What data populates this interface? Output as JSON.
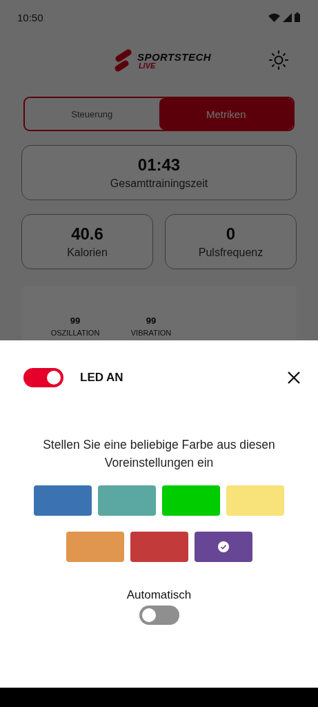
{
  "status_bar": {
    "time": "10:50"
  },
  "header": {
    "brand": "SPORTSTECH",
    "sub": "LIVE"
  },
  "tabs": [
    {
      "label": "Steuerung",
      "selected": false
    },
    {
      "label": "Metriken",
      "selected": true
    }
  ],
  "metrics": [
    {
      "value": "01:43",
      "label": "Gesamttrainingszeit"
    },
    {
      "value": "40.6",
      "label": "Kalorien"
    },
    {
      "value": "0",
      "label": "Pulsfrequenz"
    }
  ],
  "panel": {
    "stats": [
      {
        "value": "99",
        "label": "OSZILLATION"
      },
      {
        "value": "99",
        "label": "VIBRATION"
      }
    ]
  },
  "sheet": {
    "led_toggle": {
      "on": true,
      "label": "LED AN"
    },
    "prompt": "Stellen Sie eine beliebige Farbe aus diesen Voreinstellungen ein",
    "swatch_rows": [
      [
        {
          "color": "#3b73b2",
          "selected": false
        },
        {
          "color": "#5aa8a1",
          "selected": false
        },
        {
          "color": "#00cc00",
          "selected": false
        },
        {
          "color": "#f8e27a",
          "selected": false
        }
      ],
      [
        {
          "color": "#e0964e",
          "selected": false
        },
        {
          "color": "#c23b3a",
          "selected": false
        },
        {
          "color": "#674696",
          "selected": true
        }
      ]
    ],
    "auto": {
      "label": "Automatisch",
      "on": false
    }
  }
}
